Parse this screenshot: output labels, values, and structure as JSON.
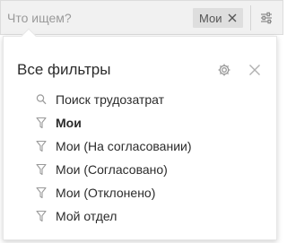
{
  "search": {
    "placeholder": "Что ищем?"
  },
  "active_filter_chip": {
    "label": "Мои"
  },
  "panel": {
    "title": "Все фильтры"
  },
  "items": [
    {
      "label": "Поиск трудозатрат",
      "icon": "search-icon",
      "bold": false
    },
    {
      "label": "Мои",
      "icon": "filter-icon",
      "bold": true
    },
    {
      "label": "Мои (На согласовании)",
      "icon": "filter-icon",
      "bold": false
    },
    {
      "label": "Мои (Согласовано)",
      "icon": "filter-icon",
      "bold": false
    },
    {
      "label": "Мои (Отклонено)",
      "icon": "filter-icon",
      "bold": false
    },
    {
      "label": "Мой отдел",
      "icon": "filter-icon",
      "bold": false
    }
  ],
  "colors": {
    "bar_background": "#f1f1f1",
    "chip_background": "#dedede",
    "icon_gray": "#9a9a9a",
    "text": "#2b2b2b"
  }
}
